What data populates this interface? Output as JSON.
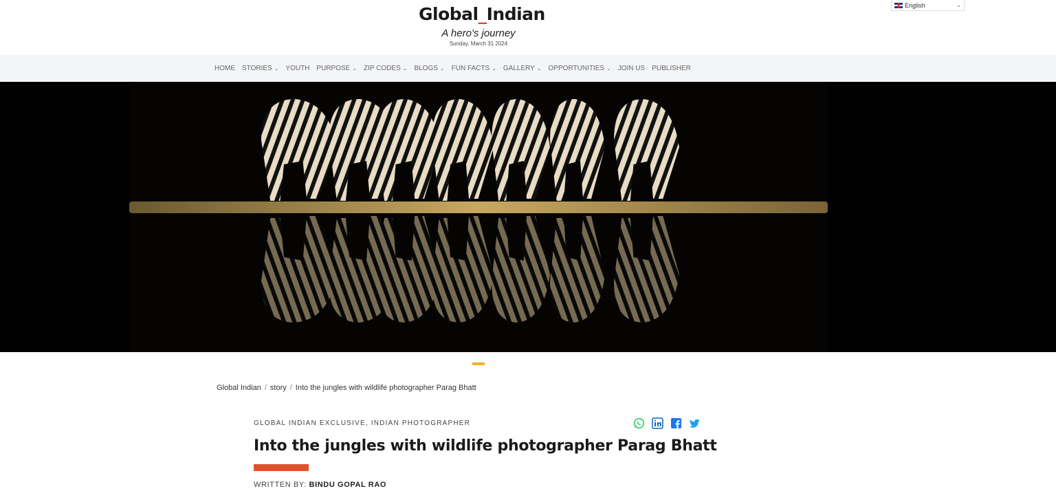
{
  "header": {
    "logo_part1": "Global",
    "logo_underscore": "_",
    "logo_part2": "Indian",
    "tagline": "A hero's journey",
    "date": "Sunday, March 31 2024",
    "language": "English"
  },
  "nav": {
    "items": [
      {
        "label": "HOME",
        "dropdown": false
      },
      {
        "label": "STORIES",
        "dropdown": true
      },
      {
        "label": "YOUTH",
        "dropdown": false
      },
      {
        "label": "PURPOSE",
        "dropdown": true
      },
      {
        "label": "ZIP CODES",
        "dropdown": true
      },
      {
        "label": "BLOGS",
        "dropdown": true
      },
      {
        "label": "FUN FACTS",
        "dropdown": true
      },
      {
        "label": "GALLERY",
        "dropdown": true
      },
      {
        "label": "OPPORTUNITIES",
        "dropdown": true
      },
      {
        "label": "JOIN US",
        "dropdown": false
      },
      {
        "label": "PUBLISHER",
        "dropdown": false
      }
    ],
    "caret": "⌄"
  },
  "breadcrumb": {
    "items": [
      "Global Indian",
      "story",
      "Into the jungles with wildlife photographer Parag Bhatt"
    ],
    "separator": "/"
  },
  "article": {
    "categories": "GLOBAL INDIAN EXCLUSIVE, INDIAN PHOTOGRAPHER",
    "title": "Into the jungles with wildlife photographer Parag Bhatt",
    "byline_label": "WRITTEN BY:",
    "author": "BINDU GOPAL RAO"
  },
  "colors": {
    "accent_red": "#e0502a",
    "divider_yellow": "#f0b323",
    "nav_bg": "#f4f5f7",
    "whatsapp": "#25d366",
    "linkedin": "#0a66c2",
    "facebook": "#1877f2",
    "twitter": "#1da1f2"
  }
}
